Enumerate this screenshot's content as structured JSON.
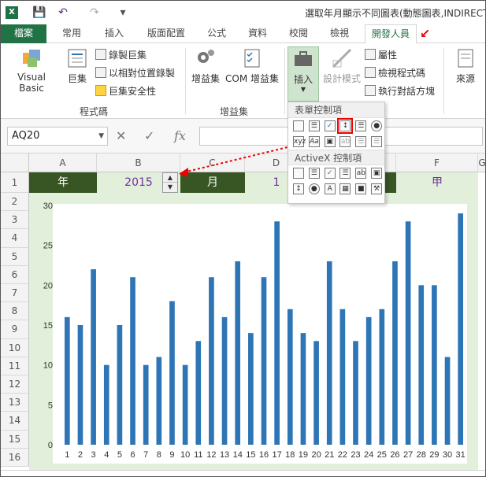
{
  "window": {
    "title": "選取年月顯示不同圖表(動態圖表,INDIRECT"
  },
  "tabs": [
    "檔案",
    "常用",
    "插入",
    "版面配置",
    "公式",
    "資料",
    "校閱",
    "檢視",
    "開發人員"
  ],
  "ribbon": {
    "code_group": {
      "label": "程式碼",
      "visual_basic": "Visual Basic",
      "macros": "巨集",
      "record_macro": "錄製巨集",
      "relative_ref": "以相對位置錄製",
      "macro_security": "巨集安全性"
    },
    "addins_group": {
      "label": "增益集",
      "addins": "增益集",
      "com_addins": "COM 增益集"
    },
    "controls_group": {
      "insert": "插入",
      "design_mode": "設計模式",
      "properties": "屬性",
      "view_code": "檢視程式碼",
      "run_dialog": "執行對話方塊"
    },
    "xml_group": {
      "source": "來源"
    }
  },
  "insert_dropdown": {
    "form_controls": "表單控制項",
    "activex_controls": "ActiveX 控制項"
  },
  "formula_bar": {
    "name_box": "AQ20",
    "fx": "fx"
  },
  "columns": [
    "A",
    "B",
    "C",
    "D",
    "E",
    "F",
    "G"
  ],
  "rows": [
    "1",
    "2",
    "3",
    "4",
    "5",
    "6",
    "7",
    "8",
    "9",
    "10",
    "11",
    "12",
    "13",
    "14",
    "15",
    "16"
  ],
  "row1": {
    "year_label": "年",
    "year_value": "2015",
    "month_label": "月",
    "month_value": "1",
    "type_value": "甲"
  },
  "colors": {
    "excel_green": "#217346",
    "band_dark": "#375623",
    "band_light": "#e2efda",
    "bar": "#2e75b6"
  },
  "chart_data": {
    "type": "bar",
    "categories": [
      "1",
      "2",
      "3",
      "4",
      "5",
      "6",
      "7",
      "8",
      "9",
      "10",
      "11",
      "12",
      "13",
      "14",
      "15",
      "16",
      "17",
      "18",
      "19",
      "20",
      "21",
      "22",
      "23",
      "24",
      "25",
      "26",
      "27",
      "28",
      "29",
      "30",
      "31"
    ],
    "values": [
      16,
      15,
      22,
      10,
      15,
      21,
      10,
      11,
      18,
      10,
      13,
      21,
      16,
      23,
      14,
      21,
      28,
      17,
      14,
      13,
      23,
      17,
      13,
      16,
      17,
      23,
      28,
      20,
      20,
      11,
      29
    ],
    "ylim": [
      0,
      30
    ],
    "yticks": [
      0,
      5,
      10,
      15,
      20,
      25,
      30
    ],
    "grid": false,
    "legend": "none"
  }
}
